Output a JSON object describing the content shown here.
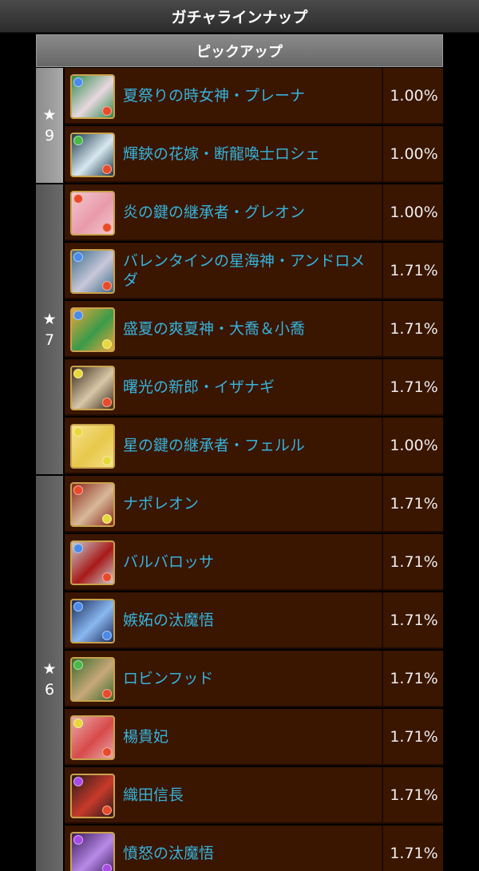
{
  "header": {
    "title": "ガチャラインナップ"
  },
  "pickup": {
    "title": "ピックアップ"
  },
  "groups": [
    {
      "star": "★",
      "rarity": "9",
      "style": "light",
      "items": [
        {
          "name": "夏祭りの時女神・プレーナ",
          "rate": "1.00%",
          "colors": [
            "#2f8a4a",
            "#e8d8e0"
          ],
          "main": "#4a8ae8",
          "sub": "#e84a2a"
        },
        {
          "name": "輝鋏の花嫁・断龍喚士ロシェ",
          "rate": "1.00%",
          "colors": [
            "#1e3a4a",
            "#d8e8f0"
          ],
          "main": "#48b848",
          "sub": "#e84a2a"
        }
      ]
    },
    {
      "star": "★",
      "rarity": "7",
      "style": "dark",
      "items": [
        {
          "name": "炎の鍵の継承者・グレオン",
          "rate": "1.00%",
          "colors": [
            "#f4c8d0",
            "#e89aaa"
          ],
          "main": "#e84a2a",
          "sub": "#e84a2a"
        },
        {
          "name": "バレンタインの星海神・アンドロメダ",
          "rate": "1.71%",
          "colors": [
            "#3a6a8a",
            "#c8c8d8"
          ],
          "main": "#4a8ae8",
          "sub": "#e84a2a"
        },
        {
          "name": "盛夏の爽夏神・大喬＆小喬",
          "rate": "1.71%",
          "colors": [
            "#e8a83a",
            "#3a9a4a"
          ],
          "main": "#4a8ae8",
          "sub": "#e8d83a"
        },
        {
          "name": "曙光の新郎・イザナギ",
          "rate": "1.71%",
          "colors": [
            "#3a2a1a",
            "#d8c8a8"
          ],
          "main": "#e8d83a",
          "sub": "#e84a2a"
        },
        {
          "name": "星の鍵の継承者・フェルル",
          "rate": "1.00%",
          "colors": [
            "#f4e08a",
            "#e8c84a"
          ],
          "main": "#e8d83a",
          "sub": "#e8d83a"
        }
      ]
    },
    {
      "star": "★",
      "rarity": "6",
      "style": "dark",
      "items": [
        {
          "name": "ナポレオン",
          "rate": "1.71%",
          "colors": [
            "#8a2a1a",
            "#d8b89a"
          ],
          "main": "#e84a2a",
          "sub": "#e8d83a"
        },
        {
          "name": "バルバロッサ",
          "rate": "1.71%",
          "colors": [
            "#c8c8c8",
            "#a81a1a"
          ],
          "main": "#4a8ae8",
          "sub": "#e84a2a"
        },
        {
          "name": "嫉妬の汰魔悟",
          "rate": "1.71%",
          "colors": [
            "#1a2a5a",
            "#8ab8f0"
          ],
          "main": "#4a8ae8",
          "sub": "#4a8ae8"
        },
        {
          "name": "ロビンフッド",
          "rate": "1.71%",
          "colors": [
            "#3a6a2a",
            "#c8a87a"
          ],
          "main": "#48b848",
          "sub": "#e84a2a"
        },
        {
          "name": "楊貴妃",
          "rate": "1.71%",
          "colors": [
            "#e8a8a8",
            "#d84a4a"
          ],
          "main": "#e8d83a",
          "sub": "#e84a2a"
        },
        {
          "name": "織田信長",
          "rate": "1.71%",
          "colors": [
            "#2a1a1a",
            "#c83a2a"
          ],
          "main": "#a84ae8",
          "sub": "#e84a2a"
        },
        {
          "name": "憤怒の汰魔悟",
          "rate": "1.71%",
          "colors": [
            "#3a1a5a",
            "#b88ae8"
          ],
          "main": "#a84ae8",
          "sub": "#a84ae8"
        }
      ]
    }
  ]
}
